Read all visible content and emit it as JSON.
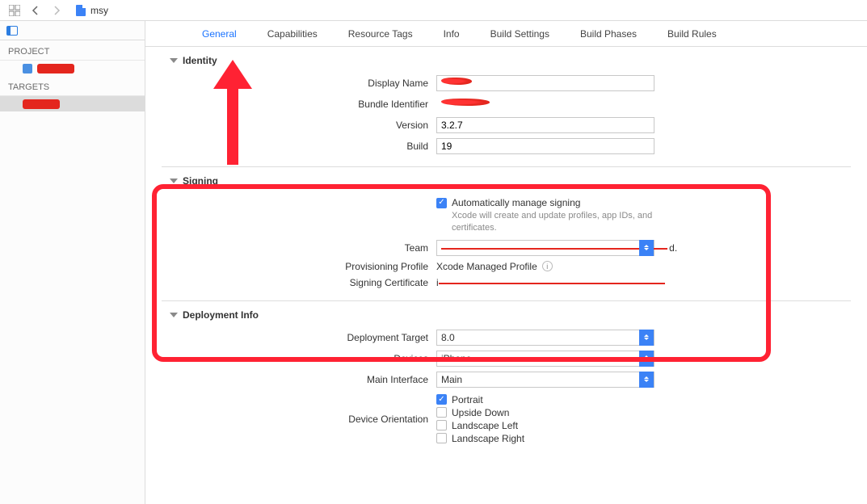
{
  "toolbar": {
    "filename": "msy"
  },
  "sidebar": {
    "project_heading": "PROJECT",
    "targets_heading": "TARGETS"
  },
  "tabs": [
    "General",
    "Capabilities",
    "Resource Tags",
    "Info",
    "Build Settings",
    "Build Phases",
    "Build Rules"
  ],
  "identity": {
    "section_title": "Identity",
    "display_name_label": "Display Name",
    "bundle_id_label": "Bundle Identifier",
    "version_label": "Version",
    "version_value": "3.2.7",
    "build_label": "Build",
    "build_value": "19"
  },
  "signing": {
    "section_title": "Signing",
    "auto_label": "Automatically manage signing",
    "auto_help": "Xcode will create and update profiles, app IDs, and certificates.",
    "team_label": "Team",
    "team_value_suffix": "d.",
    "profile_label": "Provisioning Profile",
    "profile_value": "Xcode Managed Profile",
    "cert_label": "Signing Certificate",
    "cert_prefix": "i"
  },
  "deployment": {
    "section_title": "Deployment Info",
    "target_label": "Deployment Target",
    "target_value": "8.0",
    "devices_label": "Devices",
    "devices_value": "iPhone",
    "main_if_label": "Main Interface",
    "main_if_value": "Main",
    "orientation_label": "Device Orientation",
    "orientations": [
      "Portrait",
      "Upside Down",
      "Landscape Left",
      "Landscape Right"
    ]
  }
}
